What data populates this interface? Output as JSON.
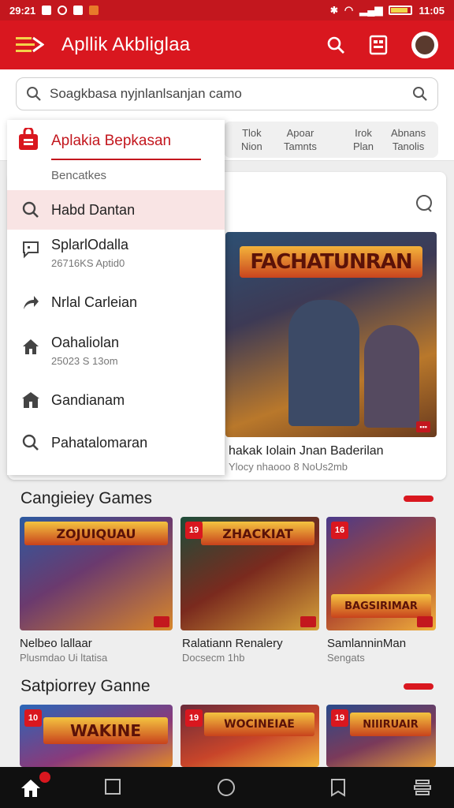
{
  "status_bar": {
    "time": "29:21",
    "clock": "11:05"
  },
  "app_bar": {
    "title": "Apllik Akbliglaa"
  },
  "search": {
    "placeholder": "Soagkbasa nyjnlanlsanjan camo"
  },
  "tabs": [
    {
      "line1": "Tlok",
      "line2": "Nion"
    },
    {
      "line1": "Apoar",
      "line2": "Tamnts"
    },
    {
      "line1": "Irok",
      "line2": "Plan"
    },
    {
      "line1": "Abnans",
      "line2": "Tanolis"
    }
  ],
  "drawer": {
    "title": "Aplakia Bepkasan",
    "subheader": "Bencatkes",
    "items": [
      {
        "label": "Habd Dantan",
        "sub": "",
        "icon": "search-icon",
        "active": true
      },
      {
        "label": "SplarlOdalla",
        "sub": "26716KS Aptid0",
        "icon": "chat-icon"
      },
      {
        "label": "Nrlal Carleian",
        "sub": "",
        "icon": "share-arrow-icon"
      },
      {
        "label": "Oahaliolan",
        "sub": "25023 S 13om",
        "icon": "home-icon"
      },
      {
        "label": "Gandianam",
        "sub": "",
        "icon": "building-icon"
      },
      {
        "label": "Pahatalomaran",
        "sub": "",
        "icon": "search-icon"
      }
    ]
  },
  "featured": {
    "banner": "FACHATUNRAN",
    "title": "hakak Iolain Jnan Baderilan",
    "subtitle": "Ylocy nhaooo 8 NoUs2mb"
  },
  "section1": {
    "heading": "Cangieiey Games",
    "games": [
      {
        "art_title": "ZOJUIQUAU",
        "badge": "",
        "label": "Nelbeo lallaar",
        "sub": "Plusmdao Ui ltatisa"
      },
      {
        "art_title": "ZHACKIAT",
        "badge": "19",
        "label": "Ralatiann Renalery",
        "sub": "Docsecm 1hb"
      },
      {
        "art_title": "BAGSIRIMAR",
        "badge": "16",
        "label": "SamlanninMan",
        "sub": "Sengats"
      }
    ]
  },
  "section2": {
    "heading": "Satpiorrey Ganne",
    "games": [
      {
        "art_title": "WAKINE",
        "badge": "10"
      },
      {
        "art_title": "WOCINEIAE",
        "badge": "19"
      },
      {
        "art_title": "NIIIRUAIR",
        "badge": "19"
      }
    ]
  },
  "colors": {
    "accent": "#d9171f",
    "status": "#c3171e",
    "drawer_active": "#f9e4e4"
  }
}
